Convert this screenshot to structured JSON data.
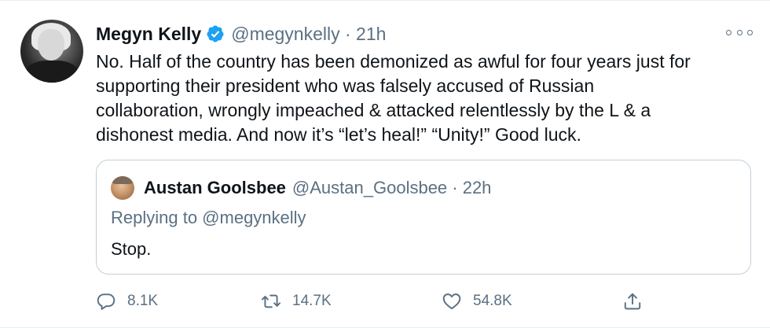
{
  "tweet": {
    "author_name": "Megyn Kelly",
    "author_handle_time": "@megynkelly · 21h",
    "text": "No. Half of the country has been demonized as awful for four years just for\nsupporting their president who was falsely accused of Russian\ncollaboration, wrongly impeached & attacked relentlessly by the L & a\ndishonest media. And now it’s “let’s heal!” “Unity!” Good luck.",
    "verified_icon": "verified-badge-icon",
    "more_icon": "more-options-icon"
  },
  "quote": {
    "author_name": "Austan Goolsbee",
    "author_handle_time": "@Austan_Goolsbee · 22h",
    "replying_to": "Replying to @megynkelly",
    "text": "Stop."
  },
  "actions": {
    "reply_count": "8.1K",
    "retweet_count": "14.7K",
    "like_count": "54.8K",
    "icons": [
      "reply-icon",
      "retweet-icon",
      "like-icon",
      "share-icon"
    ]
  },
  "colors": {
    "text": "#0f1419",
    "secondary": "#5b7083",
    "verified": "#1da1f2",
    "border": "#c4cfd6"
  }
}
